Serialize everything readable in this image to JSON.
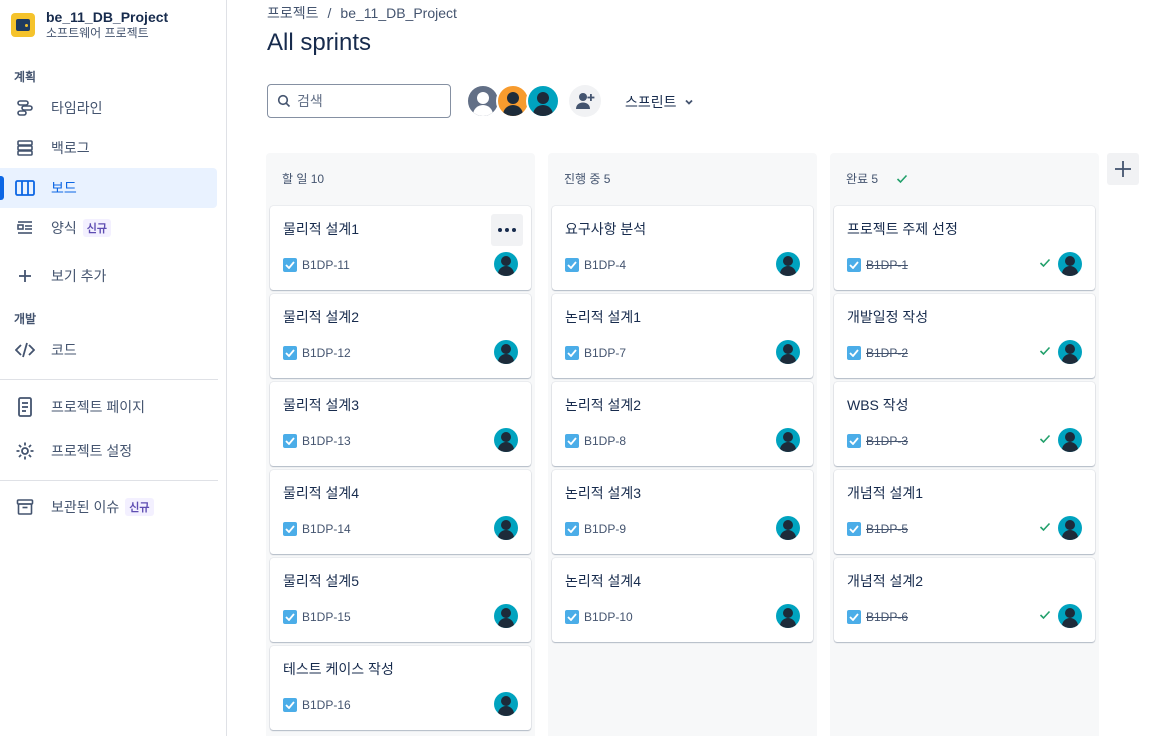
{
  "project": {
    "name": "be_11_DB_Project",
    "type": "소프트웨어 프로젝트"
  },
  "sidebar": {
    "section_plan": "계획",
    "section_dev": "개발",
    "new_badge": "신규",
    "items": [
      {
        "label": "타임라인",
        "icon": "timeline-icon"
      },
      {
        "label": "백로그",
        "icon": "backlog-icon"
      },
      {
        "label": "보드",
        "icon": "board-icon",
        "active": true
      },
      {
        "label": "양식",
        "icon": "form-icon",
        "badge": true
      },
      {
        "label": "보기 추가",
        "icon": "plus-icon"
      },
      {
        "label": "코드",
        "icon": "code-icon"
      },
      {
        "label": "프로젝트 페이지",
        "icon": "page-icon"
      },
      {
        "label": "프로젝트 설정",
        "icon": "gear-icon"
      },
      {
        "label": "보관된 이슈",
        "icon": "archive-icon",
        "badge": true
      }
    ]
  },
  "breadcrumb": {
    "root": "프로젝트",
    "separator": "/",
    "current": "be_11_DB_Project"
  },
  "page_title": "All sprints",
  "search": {
    "placeholder": "검색"
  },
  "sprint_dropdown": "스프린트",
  "columns": [
    {
      "header": "할 일 10",
      "cards": [
        {
          "title": "물리적 설계1",
          "key": "B1DP-11"
        },
        {
          "title": "물리적 설계2",
          "key": "B1DP-12"
        },
        {
          "title": "물리적 설계3",
          "key": "B1DP-13"
        },
        {
          "title": "물리적 설계4",
          "key": "B1DP-14"
        },
        {
          "title": "물리적 설계5",
          "key": "B1DP-15"
        },
        {
          "title": "테스트 케이스 작성",
          "key": "B1DP-16"
        }
      ]
    },
    {
      "header": "진행 중 5",
      "cards": [
        {
          "title": "요구사항 분석",
          "key": "B1DP-4"
        },
        {
          "title": "논리적 설계1",
          "key": "B1DP-7"
        },
        {
          "title": "논리적 설계2",
          "key": "B1DP-8"
        },
        {
          "title": "논리적 설계3",
          "key": "B1DP-9"
        },
        {
          "title": "논리적 설계4",
          "key": "B1DP-10"
        }
      ]
    },
    {
      "header": "완료 5",
      "cards": [
        {
          "title": "프로젝트 주제 선정",
          "key": "B1DP-1"
        },
        {
          "title": "개발일정 작성",
          "key": "B1DP-2"
        },
        {
          "title": "WBS 작성",
          "key": "B1DP-3"
        },
        {
          "title": "개념적 설계1",
          "key": "B1DP-5"
        },
        {
          "title": "개념적 설계2",
          "key": "B1DP-6"
        }
      ]
    }
  ],
  "colors": {
    "accent": "#0c66e4",
    "done_green": "#22a06b",
    "task_blue": "#4bade8",
    "avatar_teal": "#00a3bf"
  }
}
